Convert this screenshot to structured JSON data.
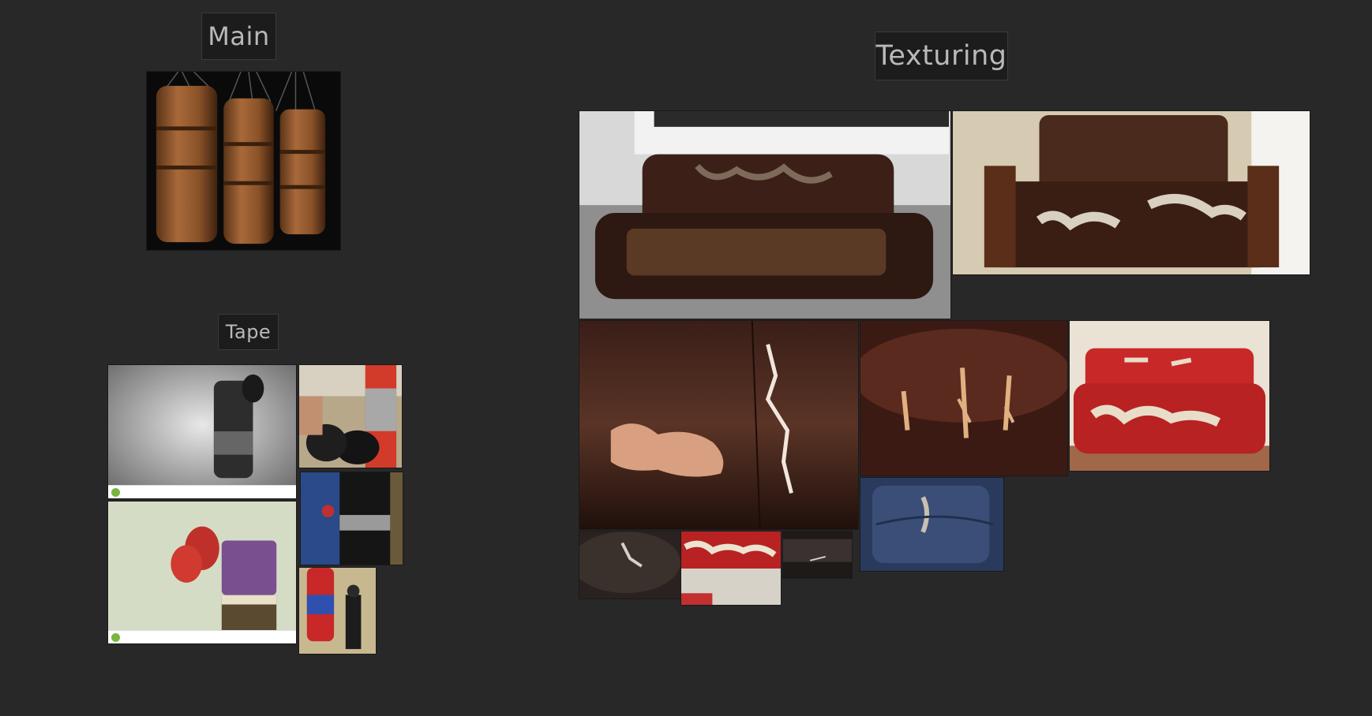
{
  "sections": {
    "main": {
      "title": "Main"
    },
    "texturing": {
      "title": "Texturing"
    },
    "tape": {
      "title": "Tape"
    }
  },
  "images": {
    "main_bags": {
      "description": "three brown leather punching bags"
    },
    "tape_bw_bag": {
      "description": "black and white taped heavy bag with gloves"
    },
    "tape_gloves_red_bag": {
      "description": "gloves near red bag with silver tape"
    },
    "tape_black_bag": {
      "description": "black bag with silver tape"
    },
    "tape_gloves_bag": {
      "description": "red gloves hanging on purple bag"
    },
    "tape_red_bag_person": {
      "description": "person next to red and blue bag"
    },
    "tex_brown_sofa": {
      "description": "brown leather sofa with peeling"
    },
    "tex_brown_sofa2": {
      "description": "brown sofa with peeling cushions"
    },
    "tex_closeup_tear": {
      "description": "close-up brown leather crack"
    },
    "tex_armrest": {
      "description": "brown leather armrest scratches"
    },
    "tex_red_sofa": {
      "description": "red leather sofa peeling"
    },
    "tex_blue_leather": {
      "description": "blue leather tear"
    },
    "tex_small1": {
      "description": "dark leather scratch"
    },
    "tex_small2": {
      "description": "red leather peel"
    },
    "tex_small3": {
      "description": "dark leather crack"
    }
  },
  "colors": {
    "background": "#282828",
    "label_bg": "#1c1c1c",
    "label_text": "#b9b9b9"
  }
}
